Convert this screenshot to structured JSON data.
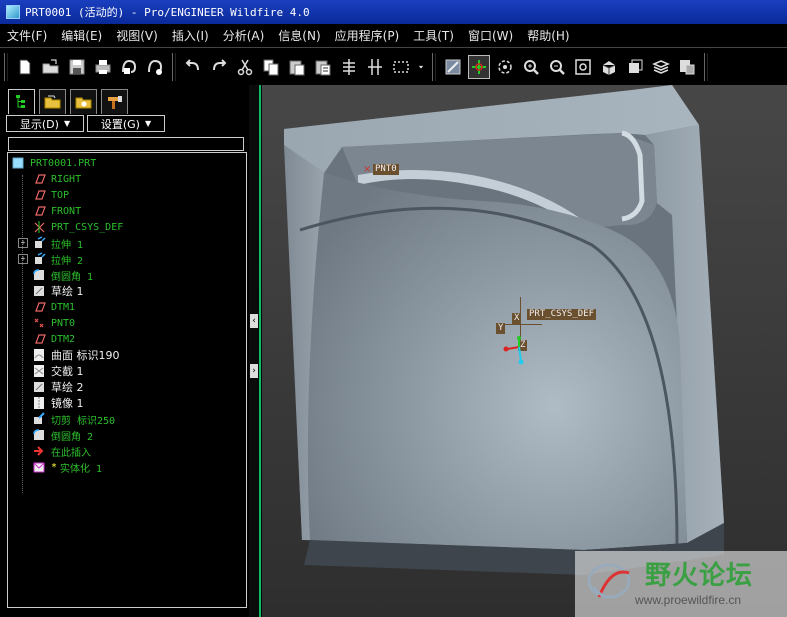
{
  "window": {
    "title": "PRT0001 (活动的) - Pro/ENGINEER Wildfire 4.0"
  },
  "menu": [
    "文件(F)",
    "编辑(E)",
    "视图(V)",
    "插入(I)",
    "分析(A)",
    "信息(N)",
    "应用程序(P)",
    "工具(T)",
    "窗口(W)",
    "帮助(H)"
  ],
  "toolbar": {
    "groups": [
      [
        "new-icon",
        "open-icon",
        "save-icon",
        "print-icon",
        "email-icon",
        "email-link-icon"
      ],
      [
        "undo-icon",
        "redo-icon",
        "cut-icon",
        "copy-icon",
        "paste-icon",
        "paste-special-icon",
        "regenerate-icon",
        "regen-manager-icon",
        "select-box-icon",
        "dropdown-icon"
      ],
      [
        "repaint-icon",
        "spin-center-icon",
        "orient-mode-icon",
        "zoom-in-icon",
        "zoom-out-icon",
        "refit-icon",
        "reorient-icon",
        "saved-views-icon",
        "layers-icon",
        "view-manager-icon"
      ]
    ],
    "active": "spin-center-icon"
  },
  "navigator": {
    "tabs": [
      "model-tree-icon",
      "folder-browser-icon",
      "favorites-icon",
      "connections-icon"
    ],
    "display_label": "显示(D)",
    "settings_label": "设置(G)",
    "tree": [
      {
        "label": "PRT0001.PRT",
        "icon": "part-icon",
        "level": 0,
        "style": "green"
      },
      {
        "label": "RIGHT",
        "icon": "datum-plane-icon",
        "level": 1,
        "style": "green"
      },
      {
        "label": "TOP",
        "icon": "datum-plane-icon",
        "level": 1,
        "style": "green"
      },
      {
        "label": "FRONT",
        "icon": "datum-plane-icon",
        "level": 1,
        "style": "green"
      },
      {
        "label": "PRT_CSYS_DEF",
        "icon": "csys-icon",
        "level": 1,
        "style": "green"
      },
      {
        "label": "拉伸 1",
        "icon": "extrude-icon",
        "level": 1,
        "style": "green",
        "expandable": true
      },
      {
        "label": "拉伸 2",
        "icon": "extrude-icon",
        "level": 1,
        "style": "green",
        "expandable": true
      },
      {
        "label": "倒圆角 1",
        "icon": "round-icon",
        "level": 1,
        "style": "green"
      },
      {
        "label": "草绘 1",
        "icon": "sketch-icon",
        "level": 1,
        "style": "white"
      },
      {
        "label": "DTM1",
        "icon": "datum-plane-icon",
        "level": 1,
        "style": "green"
      },
      {
        "label": "PNT0",
        "icon": "datum-point-icon",
        "level": 1,
        "style": "green"
      },
      {
        "label": "DTM2",
        "icon": "datum-plane-icon",
        "level": 1,
        "style": "green"
      },
      {
        "label": "曲面 标识190",
        "icon": "surface-icon",
        "level": 1,
        "style": "white"
      },
      {
        "label": "交截 1",
        "icon": "intersect-icon",
        "level": 1,
        "style": "white"
      },
      {
        "label": "草绘 2",
        "icon": "sketch-icon",
        "level": 1,
        "style": "white"
      },
      {
        "label": "镜像 1",
        "icon": "mirror-icon",
        "level": 1,
        "style": "white"
      },
      {
        "label": "切剪 标识250",
        "icon": "cut-feature-icon",
        "level": 1,
        "style": "green"
      },
      {
        "label": "倒圆角 2",
        "icon": "round-icon",
        "level": 1,
        "style": "green"
      },
      {
        "label": "在此插入",
        "icon": "insert-here-icon",
        "level": 1,
        "style": "green"
      },
      {
        "label": "实体化 1",
        "icon": "solidify-icon",
        "level": 1,
        "style": "green",
        "prefix": "*"
      }
    ]
  },
  "viewport": {
    "labels": {
      "point": "PNT0",
      "csys": "PRT_CSYS_DEF",
      "axis_x": "X",
      "axis_y": "Y",
      "axis_z": "Z"
    }
  },
  "watermark": {
    "name": "野火论坛",
    "url": "www.proewildfire.cn"
  }
}
